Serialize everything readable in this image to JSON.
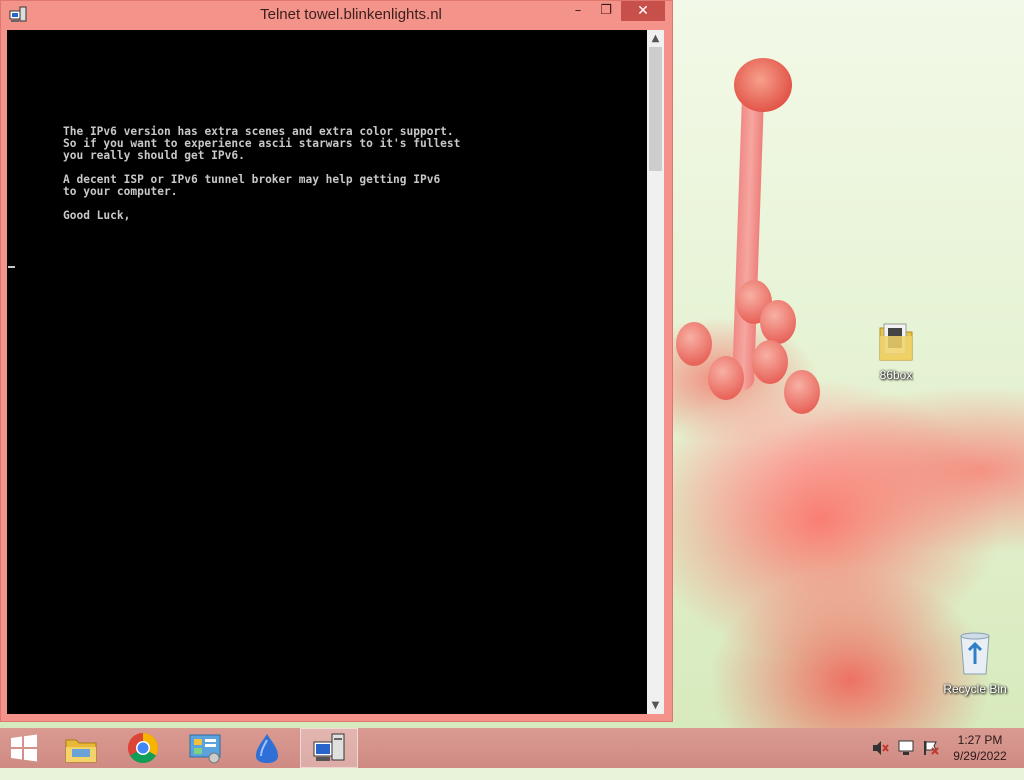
{
  "window": {
    "title": "Telnet towel.blinkenlights.nl",
    "minimize": "–",
    "maximize": "❐",
    "close": "✕"
  },
  "console": {
    "text": "The IPv6 version has extra scenes and extra color support.\nSo if you want to experience ascii starwars to it's fullest\nyou really should get IPv6.\n\nA decent ISP or IPv6 tunnel broker may help getting IPv6\nto your computer.\n\nGood Luck,"
  },
  "desktop": {
    "icons": [
      {
        "label": "86box",
        "icon": "folder-icon"
      },
      {
        "label": "Recycle Bin",
        "icon": "recycle-bin-icon"
      }
    ]
  },
  "taskbar": {
    "items": [
      {
        "name": "start-button",
        "icon": "windows-logo-icon"
      },
      {
        "name": "file-explorer",
        "icon": "folder-icon"
      },
      {
        "name": "chrome",
        "icon": "chrome-icon"
      },
      {
        "name": "control-panel",
        "icon": "control-panel-icon"
      },
      {
        "name": "app-blue",
        "icon": "blue-hand-icon"
      },
      {
        "name": "telnet",
        "icon": "telnet-icon",
        "active": true
      }
    ],
    "tray": {
      "icons": [
        "volume-muted-icon",
        "network-icon",
        "action-center-flag-icon"
      ]
    },
    "clock": {
      "time": "1:27 PM",
      "date": "9/29/2022"
    }
  },
  "colors": {
    "window_frame": "#f39389",
    "console_bg": "#000000",
    "console_fg": "#c8c8c8",
    "taskbar": "#d4938b",
    "close_button": "#c7504a"
  }
}
